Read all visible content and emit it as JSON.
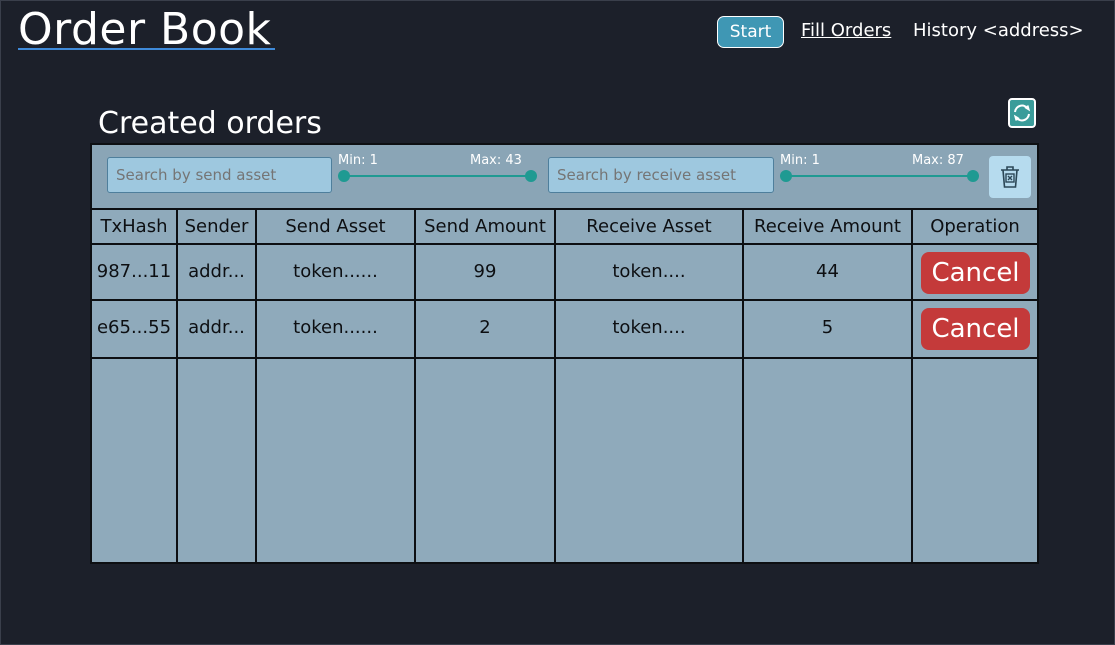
{
  "app": {
    "title": "Order Book"
  },
  "nav": {
    "start": "Start",
    "fill_orders": "Fill Orders",
    "history": "History <address>"
  },
  "section": {
    "title": "Created orders"
  },
  "filters": {
    "send_search_placeholder": "Search by send asset",
    "send_min": "Min: 1",
    "send_max": "Max: 43",
    "receive_search_placeholder": "Search by receive asset",
    "receive_min": "Min: 1",
    "receive_max": "Max: 87"
  },
  "table": {
    "headers": [
      "TxHash",
      "Sender",
      "Send Asset",
      "Send Amount",
      "Receive Asset",
      "Receive Amount",
      "Operation"
    ],
    "rows": [
      {
        "txhash": "987...11",
        "sender": "addr...",
        "send_asset": "token......",
        "send_amount": "99",
        "receive_asset": "token....",
        "receive_amount": "44",
        "action": "Cancel"
      },
      {
        "txhash": "e65...55",
        "sender": "addr...",
        "send_asset": "token......",
        "send_amount": "2",
        "receive_asset": "token....",
        "receive_amount": "5",
        "action": "Cancel"
      }
    ]
  },
  "icons": {
    "refresh": "refresh-icon",
    "clear_filters": "trash-clear-icon"
  },
  "colors": {
    "background": "#1c202a",
    "panel": "#8faabb",
    "accent": "#3f97b4",
    "slider": "#1f9a92",
    "cancel": "#c43a3a"
  }
}
